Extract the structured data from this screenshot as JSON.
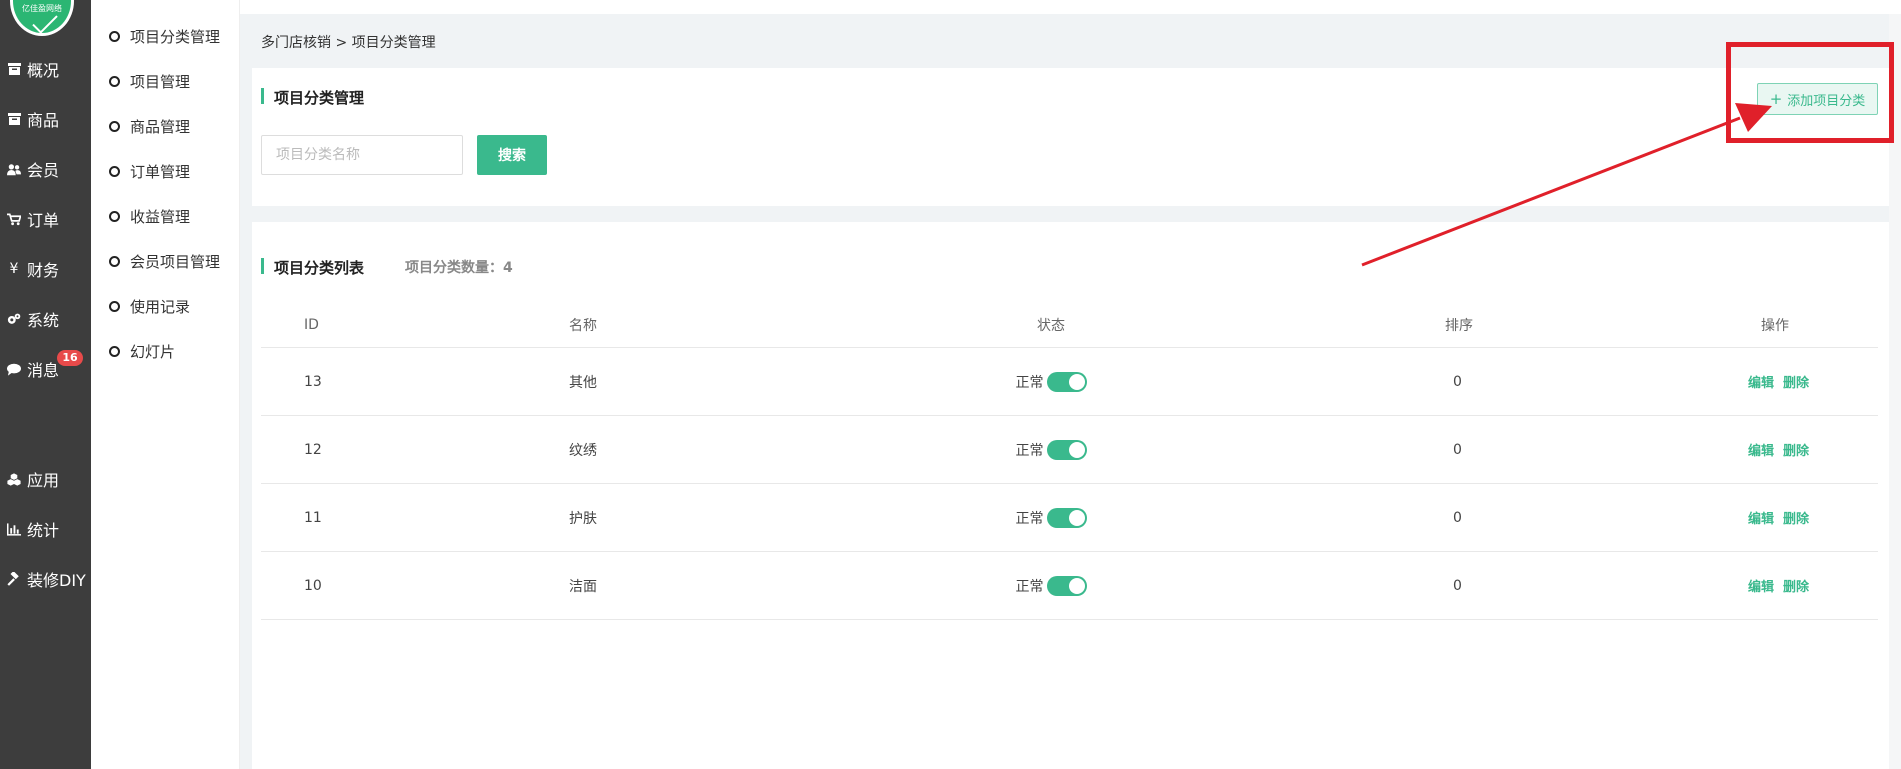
{
  "logo": {
    "text": "亿佳盈网络"
  },
  "nav": {
    "items": [
      {
        "label": "概况",
        "icon": "archive-icon"
      },
      {
        "label": "商品",
        "icon": "box-icon"
      },
      {
        "label": "会员",
        "icon": "users-icon"
      },
      {
        "label": "订单",
        "icon": "cart-icon"
      },
      {
        "label": "财务",
        "icon": "yen-icon"
      },
      {
        "label": "系统",
        "icon": "gears-icon"
      },
      {
        "label": "消息",
        "icon": "chat-icon",
        "badge": "16"
      },
      {
        "label": "应用",
        "icon": "cubes-icon"
      },
      {
        "label": "统计",
        "icon": "bar-chart-icon"
      },
      {
        "label": "装修DIY",
        "icon": "gavel-icon"
      }
    ]
  },
  "subnav": {
    "items": [
      {
        "label": "项目分类管理"
      },
      {
        "label": "项目管理"
      },
      {
        "label": "商品管理"
      },
      {
        "label": "订单管理"
      },
      {
        "label": "收益管理"
      },
      {
        "label": "会员项目管理"
      },
      {
        "label": "使用记录"
      },
      {
        "label": "幻灯片"
      }
    ]
  },
  "breadcrumb": "多门店核销 > 项目分类管理",
  "manage": {
    "title": "项目分类管理",
    "add_button": "添加项目分类",
    "add_plus": "+",
    "search_placeholder": "项目分类名称",
    "search_button": "搜索"
  },
  "list": {
    "title": "项目分类列表",
    "count_label": "项目分类数量：4",
    "columns": [
      "ID",
      "名称",
      "状态",
      "排序",
      "操作"
    ],
    "rows": [
      {
        "id": "13",
        "name": "其他",
        "status": "正常",
        "sort": "0",
        "enabled": true
      },
      {
        "id": "12",
        "name": "纹绣",
        "status": "正常",
        "sort": "0",
        "enabled": true
      },
      {
        "id": "11",
        "name": "护肤",
        "status": "正常",
        "sort": "0",
        "enabled": true
      },
      {
        "id": "10",
        "name": "洁面",
        "status": "正常",
        "sort": "0",
        "enabled": true
      }
    ],
    "edit_label": "编辑",
    "delete_label": "删除"
  },
  "colors": {
    "accent": "#3ab98d",
    "nav_bg": "#3d3d3d",
    "annotation": "#e0202a",
    "badge": "#e84a4a"
  }
}
